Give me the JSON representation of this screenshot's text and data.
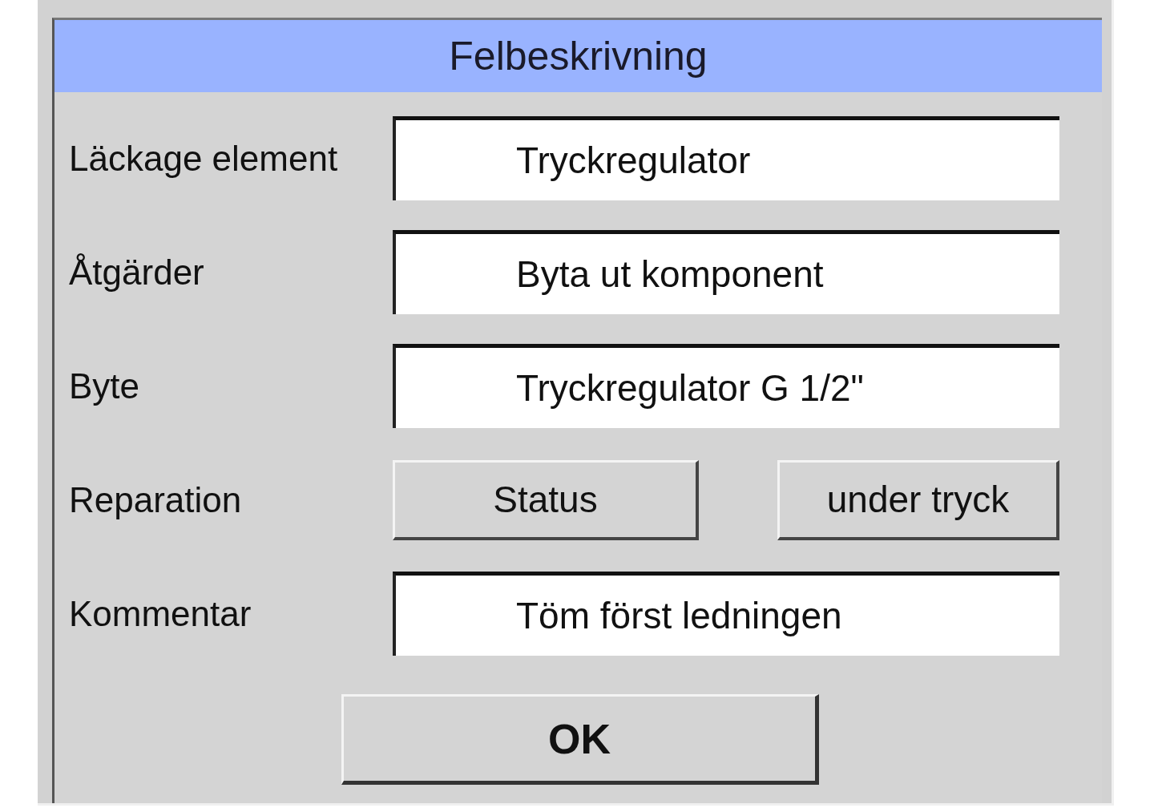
{
  "dialog": {
    "title": "Felbeskrivning",
    "rows": [
      {
        "kind": "field",
        "label": "Läckage element",
        "value": "Tryckregulator"
      },
      {
        "kind": "field",
        "label": "Åtgärder",
        "value": "Byta ut komponent"
      },
      {
        "kind": "field",
        "label": "Byte",
        "value": "Tryckregulator G 1/2\""
      },
      {
        "kind": "buttons",
        "label": "Reparation",
        "buttons": [
          "Status",
          "under tryck"
        ]
      },
      {
        "kind": "field",
        "label": "Kommentar",
        "value": "Töm först ledningen"
      }
    ],
    "ok_button": "OK"
  }
}
